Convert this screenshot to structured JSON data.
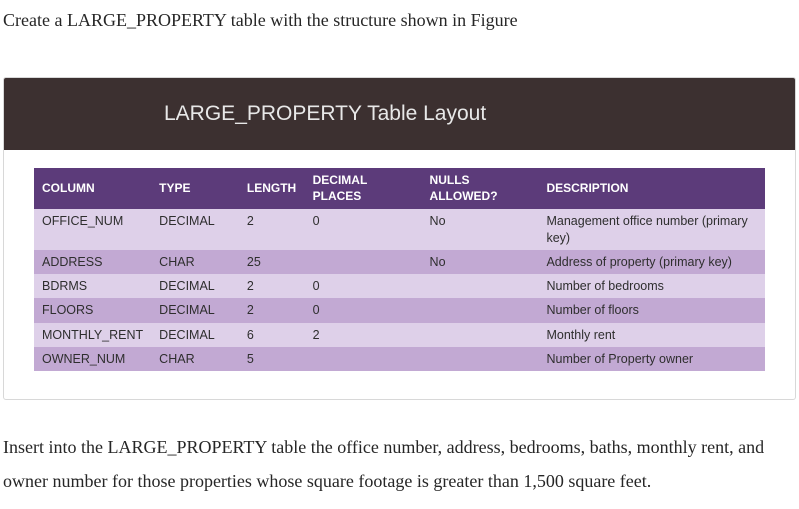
{
  "intro": "Create a LARGE_PROPERTY table with the structure shown in Figure",
  "figureTitle": "LARGE_PROPERTY Table Layout",
  "table": {
    "headers": {
      "column": "COLUMN",
      "type": "TYPE",
      "length": "LENGTH",
      "decimal": "DECIMAL PLACES",
      "nulls": "NULLS ALLOWED?",
      "desc": "DESCRIPTION"
    },
    "rows": [
      {
        "column": "OFFICE_NUM",
        "type": "DECIMAL",
        "length": "2",
        "decimal": "0",
        "nulls": "No",
        "desc": "Management office number (primary key)",
        "shade": "light"
      },
      {
        "column": "ADDRESS",
        "type": "CHAR",
        "length": "25",
        "decimal": "",
        "nulls": "No",
        "desc": "Address of property (primary key)",
        "shade": "dark"
      },
      {
        "column": "BDRMS",
        "type": "DECIMAL",
        "length": "2",
        "decimal": "0",
        "nulls": "",
        "desc": "Number of bedrooms",
        "shade": "light"
      },
      {
        "column": "FLOORS",
        "type": "DECIMAL",
        "length": "2",
        "decimal": "0",
        "nulls": "",
        "desc": "Number of floors",
        "shade": "dark"
      },
      {
        "column": "MONTHLY_RENT",
        "type": "DECIMAL",
        "length": "6",
        "decimal": "2",
        "nulls": "",
        "desc": "Monthly rent",
        "shade": "light"
      },
      {
        "column": "OWNER_NUM",
        "type": "CHAR",
        "length": "5",
        "decimal": "",
        "nulls": "",
        "desc": "Number of Property owner",
        "shade": "dark"
      }
    ]
  },
  "outro": "Insert into the LARGE_PROPERTY table the office number, address, bedrooms, baths, monthly rent, and owner number for those properties whose square footage is greater than 1,500 square feet."
}
